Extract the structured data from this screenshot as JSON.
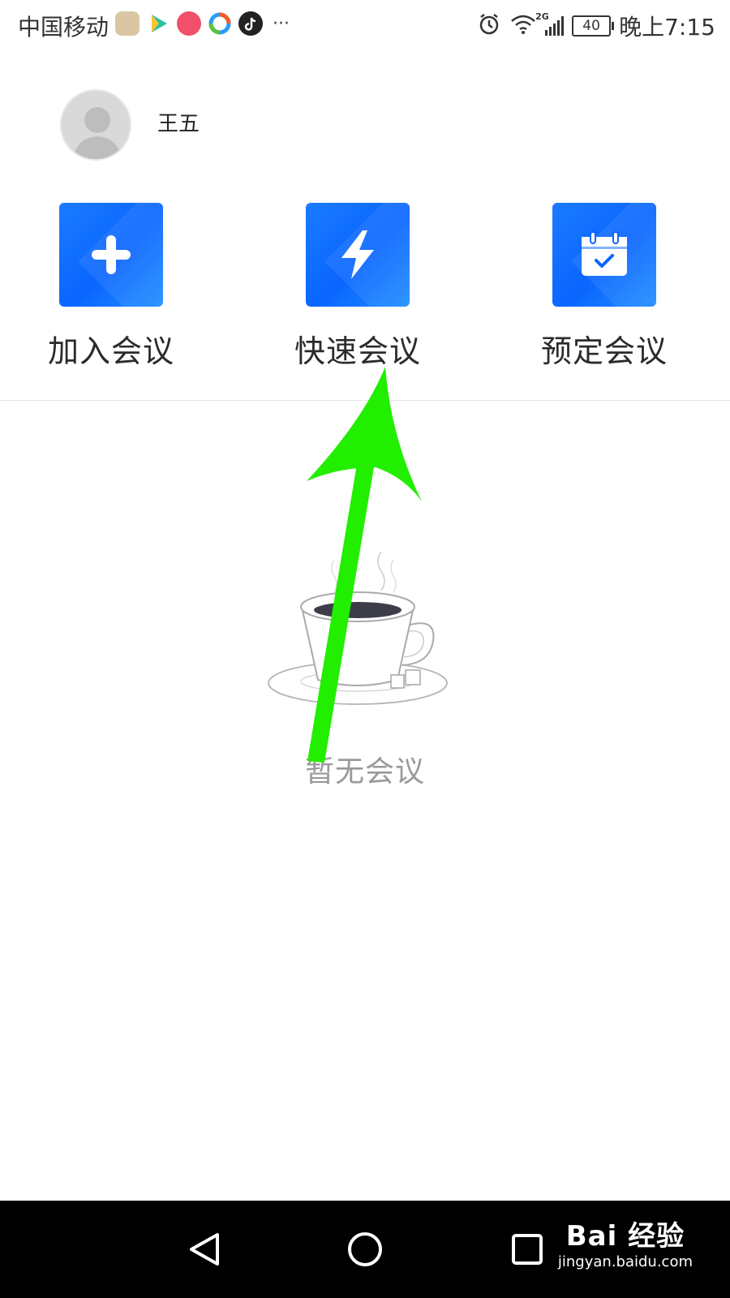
{
  "status_bar": {
    "carrier": "中国移动",
    "more": "···",
    "network": "2G",
    "battery": "40",
    "time": "晚上7:15"
  },
  "profile": {
    "name": "王五"
  },
  "actions": [
    {
      "label": "加入会议",
      "icon": "plus-icon"
    },
    {
      "label": "快速会议",
      "icon": "lightning-icon"
    },
    {
      "label": "预定会议",
      "icon": "calendar-check-icon"
    }
  ],
  "empty_state": {
    "text": "暂无会议",
    "illustration": "coffee-cup"
  },
  "watermark": {
    "logo": "Bai 经验",
    "url": "jingyan.baidu.com"
  },
  "colors": {
    "tile_blue": "#0a66ff",
    "arrow_green": "#22ee00",
    "empty_text": "#999999"
  }
}
